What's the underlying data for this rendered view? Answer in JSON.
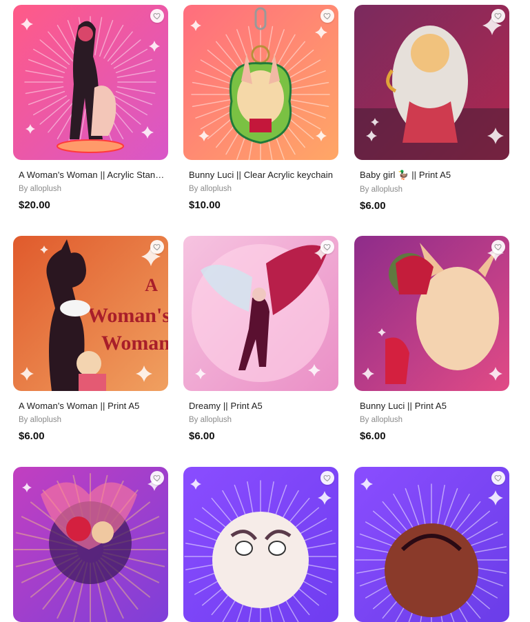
{
  "products": [
    {
      "title": "A Woman's Woman || Acrylic Standee",
      "seller": "By alloplush",
      "price": "$20.00",
      "art": "standee",
      "colors": [
        "#ff5a87",
        "#d857c8"
      ]
    },
    {
      "title": "Bunny Luci || Clear Acrylic keychain",
      "seller": "By alloplush",
      "price": "$10.00",
      "art": "keychain",
      "colors": [
        "#ff6d7e",
        "#ffa766"
      ]
    },
    {
      "title": "Baby girl 🦆 || Print A5",
      "seller": "By alloplush",
      "price": "$6.00",
      "art": "print-dark",
      "colors": [
        "#7a2a5e",
        "#b0284f"
      ]
    },
    {
      "title": "A Woman's Woman || Print A5",
      "seller": "By alloplush",
      "price": "$6.00",
      "art": "print-orange",
      "colors": [
        "#e05a2c",
        "#f0a060"
      ]
    },
    {
      "title": "Dreamy || Print A5",
      "seller": "By alloplush",
      "price": "$6.00",
      "art": "print-pink",
      "colors": [
        "#f6c3e0",
        "#ea8fc6"
      ]
    },
    {
      "title": "Bunny Luci || Print A5",
      "seller": "By alloplush",
      "price": "$6.00",
      "art": "print-magenta",
      "colors": [
        "#8e2c8a",
        "#e14b86"
      ]
    },
    {
      "title": "",
      "seller": "",
      "price": "",
      "art": "print-violet",
      "colors": [
        "#c23fc0",
        "#7e3fd9"
      ]
    },
    {
      "title": "",
      "seller": "",
      "price": "",
      "art": "sunburst-face",
      "colors": [
        "#8a4dff",
        "#6f3df0"
      ]
    },
    {
      "title": "",
      "seller": "",
      "price": "",
      "art": "sunburst-ball",
      "colors": [
        "#8a4dff",
        "#6a3de8"
      ]
    }
  ],
  "icons": {
    "favorite": "heart-icon"
  }
}
